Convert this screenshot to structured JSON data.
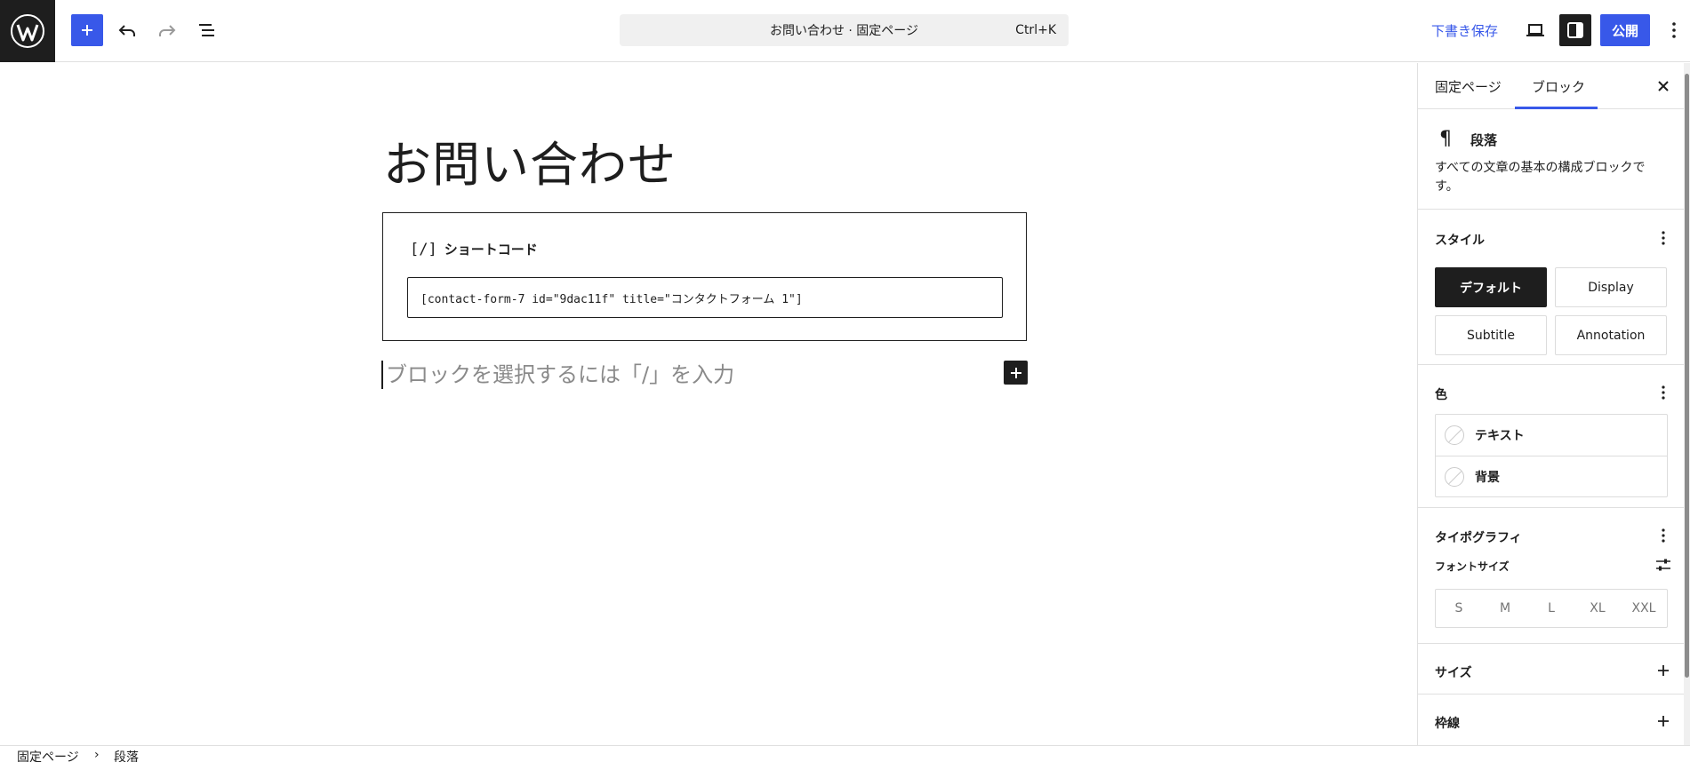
{
  "header": {
    "title_bar": "お問い合わせ · 固定ページ",
    "shortcut": "Ctrl+K",
    "save_draft": "下書き保存",
    "publish": "公開"
  },
  "editor": {
    "page_title": "お問い合わせ",
    "shortcode_block": {
      "icon": "[/]",
      "label": "ショートコード",
      "value": "[contact-form-7 id=\"9dac11f\" title=\"コンタクトフォーム 1\"]"
    },
    "placeholder": "ブロックを選択するには「/」を入力"
  },
  "sidebar": {
    "tabs": [
      "固定ページ",
      "ブロック"
    ],
    "active_tab": "ブロック",
    "block_card": {
      "icon": "¶",
      "title": "段落",
      "description": "すべての文章の基本の構成ブロックです。"
    },
    "styles": {
      "title": "スタイル",
      "options": [
        "デフォルト",
        "Display",
        "Subtitle",
        "Annotation"
      ],
      "selected": "デフォルト"
    },
    "color": {
      "title": "色",
      "items": [
        "テキスト",
        "背景"
      ]
    },
    "typography": {
      "title": "タイポグラフィ",
      "font_size_label": "フォントサイズ",
      "sizes": [
        "S",
        "M",
        "L",
        "XL",
        "XXL"
      ]
    },
    "size": {
      "title": "サイズ"
    },
    "border": {
      "title": "枠線"
    }
  },
  "breadcrumb": [
    "固定ページ",
    "段落"
  ],
  "colors": {
    "accent": "#3858e9",
    "dark": "#1e1e1e",
    "border": "#e0e0e0"
  }
}
